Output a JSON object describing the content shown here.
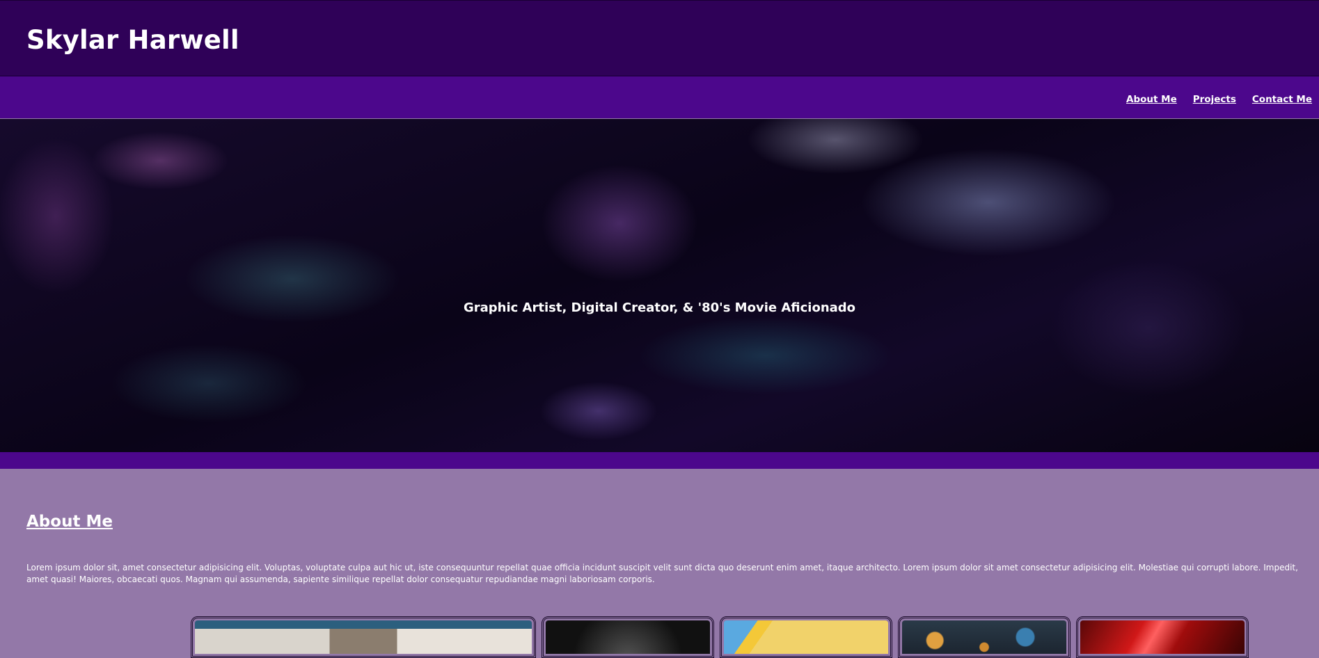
{
  "header": {
    "title": "Skylar Harwell"
  },
  "nav": {
    "items": [
      {
        "label": "About Me"
      },
      {
        "label": "Projects"
      },
      {
        "label": "Contact Me"
      }
    ]
  },
  "hero": {
    "tagline": "Graphic Artist, Digital Creator, & '80's Movie Aficionado"
  },
  "about": {
    "heading": "About Me",
    "body": "Lorem ipsum dolor sit, amet consectetur adipisicing elit. Voluptas, voluptate culpa aut hic ut, iste consequuntur repellat quae officia incidunt suscipit velit sunt dicta quo deserunt enim amet, itaque architecto. Lorem ipsum dolor sit amet consectetur adipisicing elit. Molestiae qui corrupti labore. Impedit, amet quasi! Maiores, obcaecati quos. Magnam qui assumenda, sapiente similique repellat dolor consequatur repudiandae magni laboriosam corporis."
  },
  "colors": {
    "header_bg": "#2f0158",
    "nav_bg": "#4c078c",
    "section_bg": "#9378a8",
    "text": "#ffffff"
  }
}
